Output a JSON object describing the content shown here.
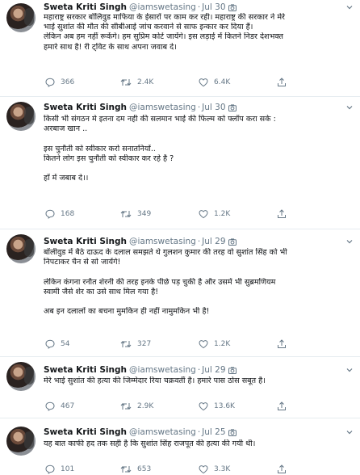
{
  "author": {
    "name": "Sweta Kriti Singh",
    "handle": "@iamswetasing"
  },
  "separator": "·",
  "tweets": [
    {
      "date": "Jul 30",
      "lines": [
        "महाराष्ट्र सरकार बॉलिवुड माफिया के ईसारों पर काम कर रही। महाराष्ट्र की सरकार ने मेरे",
        "भाई सुशांत की मौत की सीबीआई जांच करवाने से साफ इन्कार कर दिया हैं।",
        "लेकिन अब हम नहीं रूकेंगे। हम सुप्रिम कोर्ट जायेंगे। इस लड़ाई में कितने निडर देशभक्त",
        "हमारे साथ है! री ट्विट के साथ अपना जवाब दे।"
      ],
      "replies": "366",
      "retweets": "2.4K",
      "likes": "6.4K"
    },
    {
      "date": "Jul 30",
      "lines": [
        "किसी भी संगठन मे इतना दम नही की सलमान भाई की फिल्म को फ्लॉप करा सके :",
        "अरबाज खान ..",
        "",
        "इस चुनौती को स्वीकार करो सनातनियों..",
        "कितने लोग इस चुनौती को स्वीकार कर रहे है ?",
        "",
        "हाँ में जबाब दे।।"
      ],
      "replies": "168",
      "retweets": "349",
      "likes": "1.2K"
    },
    {
      "date": "Jul 29",
      "lines": [
        "बॉलीवुड में बैठे दाऊद के दलाल समझते थे गुलशन कुमार की तरह वो सुशांत सिंह को भी",
        "निपटाकर चैन से सो जायेंगे!",
        "",
        "लेकिन कंगना रनौत शेरनी की तरह इनके पीछे पड़ चुकी है और उसमें भी सुब्रमणियम",
        "स्वामी जैसे शेर का उसे साथ मिल गया है!",
        "",
        "अब इन दलालों का बचना मुमकिन ही नहीं नामुमकिन भी है!"
      ],
      "replies": "54",
      "retweets": "327",
      "likes": "1.2K"
    },
    {
      "date": "Jul 29",
      "lines": [
        "मेरे भाई सुशांत की हत्या की जिम्मेदार रिया चक्रवर्ती है। हमारे पास ठोस सबूत है।"
      ],
      "replies": "467",
      "retweets": "2.9K",
      "likes": "13.6K"
    },
    {
      "date": "Jul 25",
      "lines": [
        "यह बात काफी हद तक सही है कि सुशांत सिंह राजपूत की हत्या की गयी थी।"
      ],
      "replies": "101",
      "retweets": "653",
      "likes": "3.3K"
    }
  ],
  "colors": {
    "text": "#14171a",
    "muted": "#657786",
    "divider": "#e6ecf0"
  },
  "icons": [
    "camera-icon",
    "chevron-down-icon",
    "reply-icon",
    "retweet-icon",
    "like-icon",
    "share-icon"
  ]
}
